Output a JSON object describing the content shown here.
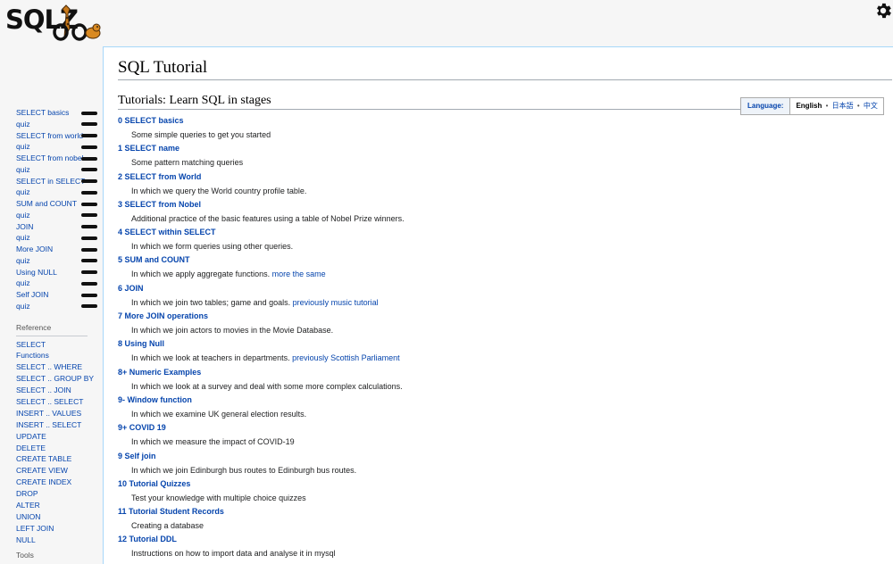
{
  "logo": {
    "text": "SQLZOO"
  },
  "sidebar": {
    "tutorial_items": [
      {
        "label": "SELECT basics"
      },
      {
        "label": "quiz"
      },
      {
        "label": "SELECT from world"
      },
      {
        "label": "quiz"
      },
      {
        "label": "SELECT from nobel"
      },
      {
        "label": "quiz"
      },
      {
        "label": "SELECT in SELECT"
      },
      {
        "label": "quiz"
      },
      {
        "label": "SUM and COUNT"
      },
      {
        "label": "quiz"
      },
      {
        "label": "JOIN"
      },
      {
        "label": "quiz"
      },
      {
        "label": "More JOIN"
      },
      {
        "label": "quiz"
      },
      {
        "label": "Using NULL"
      },
      {
        "label": "quiz"
      },
      {
        "label": "Self JOIN"
      },
      {
        "label": "quiz"
      }
    ],
    "reference_heading": "Reference",
    "reference_items": [
      "SELECT",
      "Functions",
      "SELECT .. WHERE",
      "SELECT .. GROUP BY",
      "SELECT .. JOIN",
      "SELECT .. SELECT",
      "INSERT .. VALUES",
      "INSERT .. SELECT",
      "UPDATE",
      "DELETE",
      "CREATE TABLE",
      "CREATE VIEW",
      "CREATE INDEX",
      "DROP",
      "ALTER",
      "UNION",
      "LEFT JOIN",
      "NULL"
    ],
    "tools_heading": "Tools"
  },
  "main": {
    "page_title": "SQL Tutorial",
    "section_title": "Tutorials: Learn SQL in stages",
    "language": {
      "label": "Language:",
      "current": "English",
      "others": [
        "日本語",
        "中文"
      ],
      "separator": "•"
    },
    "tutorials": [
      {
        "title": "0 SELECT basics",
        "desc": "Some simple queries to get you started",
        "link": ""
      },
      {
        "title": "1 SELECT name",
        "desc": "Some pattern matching queries",
        "link": ""
      },
      {
        "title": "2 SELECT from World",
        "desc": "In which we query the World country profile table.",
        "link": ""
      },
      {
        "title": "3 SELECT from Nobel",
        "desc": "Additional practice of the basic features using a table of Nobel Prize winners.",
        "link": ""
      },
      {
        "title": "4 SELECT within SELECT",
        "desc": "In which we form queries using other queries.",
        "link": ""
      },
      {
        "title": "5 SUM and COUNT",
        "desc": "In which we apply aggregate functions.",
        "link": "more the same"
      },
      {
        "title": "6 JOIN",
        "desc": "In which we join two tables; game and goals.",
        "link": "previously music tutorial"
      },
      {
        "title": "7 More JOIN operations",
        "desc": "In which we join actors to movies in the Movie Database.",
        "link": ""
      },
      {
        "title": "8 Using Null",
        "desc": "In which we look at teachers in departments.",
        "link": "previously Scottish Parliament"
      },
      {
        "title": "8+ Numeric Examples",
        "desc": "In which we look at a survey and deal with some more complex calculations.",
        "link": ""
      },
      {
        "title": "9- Window function",
        "desc": "In which we examine UK general election results.",
        "link": ""
      },
      {
        "title": "9+ COVID 19",
        "desc": "In which we measure the impact of COVID-19",
        "link": ""
      },
      {
        "title": "9 Self join",
        "desc": "In which we join Edinburgh bus routes to Edinburgh bus routes.",
        "link": ""
      },
      {
        "title": "10 Tutorial Quizzes",
        "desc": "Test your knowledge with multiple choice quizzes",
        "link": ""
      },
      {
        "title": "11 Tutorial Student Records",
        "desc": "Creating a database",
        "link": ""
      },
      {
        "title": "12 Tutorial DDL",
        "desc": "Instructions on how to import data and analyse it in mysql",
        "link": ""
      }
    ]
  },
  "icons": {
    "settings": "gear-icon"
  },
  "colors": {
    "link": "#0645ad",
    "background": "#f6f6f6",
    "content_border": "#a7d7f9"
  }
}
